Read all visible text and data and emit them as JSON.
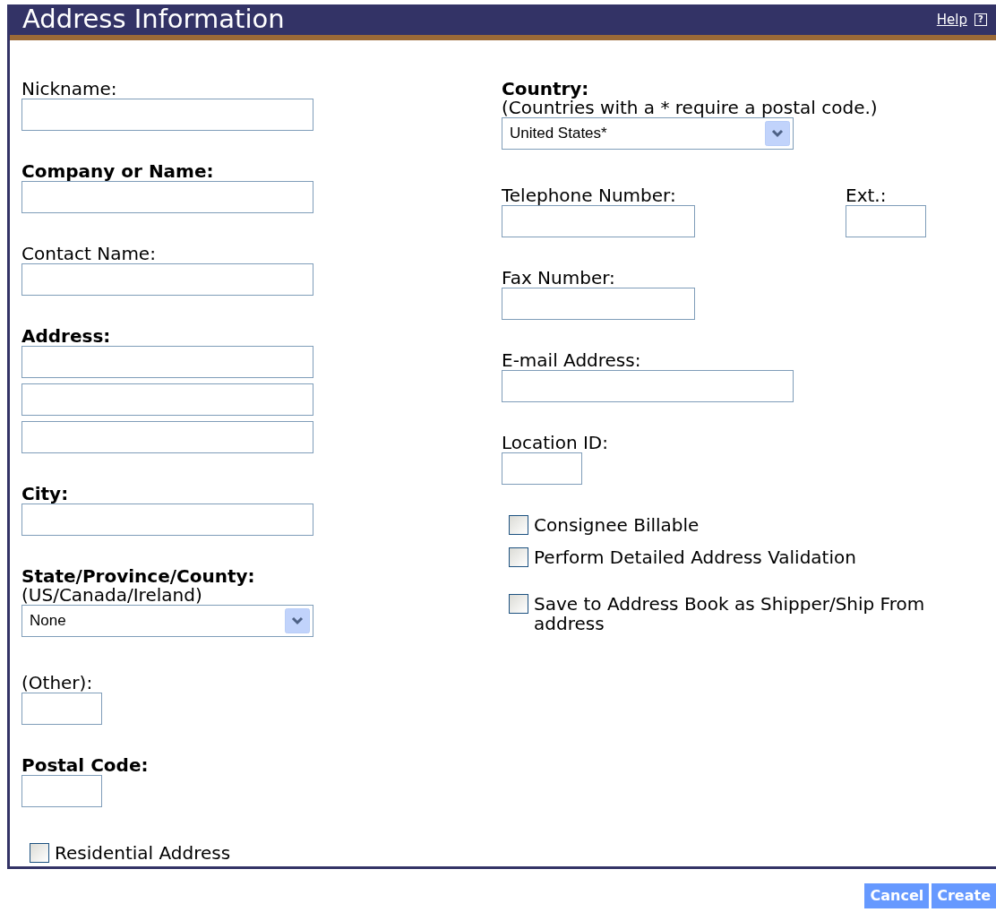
{
  "header": {
    "title": "Address Information",
    "help": "Help",
    "help_icon": "?"
  },
  "left_fields": [
    {
      "kind": "wide",
      "label": "Nickname:",
      "required": false
    },
    {
      "kind": "wide",
      "label": "Company or Name:",
      "required": true
    },
    {
      "kind": "wide",
      "label": "Contact Name:",
      "required": false
    },
    {
      "kind": "address",
      "label": "Address:",
      "required": true
    },
    {
      "kind": "wide",
      "label": "City:",
      "required": true
    },
    {
      "kind": "select",
      "label": "State/Province/County:",
      "hint": "(US/Canada/Ireland)",
      "value": "None",
      "required": true
    },
    {
      "kind": "short",
      "label": "(Other):",
      "required": false
    },
    {
      "kind": "short",
      "label": "Postal Code:",
      "required": true
    },
    {
      "kind": "checkbox",
      "label": "Residential Address",
      "checked": false
    }
  ],
  "right_fields": [
    {
      "kind": "select",
      "label": "Country:",
      "hint": "(Countries with a * require a postal code.)",
      "value": "United States*",
      "required": true
    },
    {
      "kind": "pair",
      "fields": [
        {
          "kind": "medium",
          "label": "Telephone Number:",
          "required": false
        },
        {
          "kind": "short",
          "label": "Ext.:",
          "required": false
        }
      ]
    },
    {
      "kind": "medium",
      "label": "Fax Number:",
      "required": false
    },
    {
      "kind": "wide",
      "label": "E-mail Address:",
      "required": false
    },
    {
      "kind": "short",
      "label": "Location ID:",
      "required": false
    },
    {
      "kind": "checkbox",
      "label": "Consignee Billable",
      "checked": false
    },
    {
      "kind": "checkbox",
      "label": "Perform Detailed Address Validation",
      "checked": false
    },
    {
      "kind": "checkbox",
      "label": "Save to Address Book as Shipper/Ship From address",
      "checked": false
    }
  ],
  "buttons": [
    "Cancel",
    "Create"
  ]
}
